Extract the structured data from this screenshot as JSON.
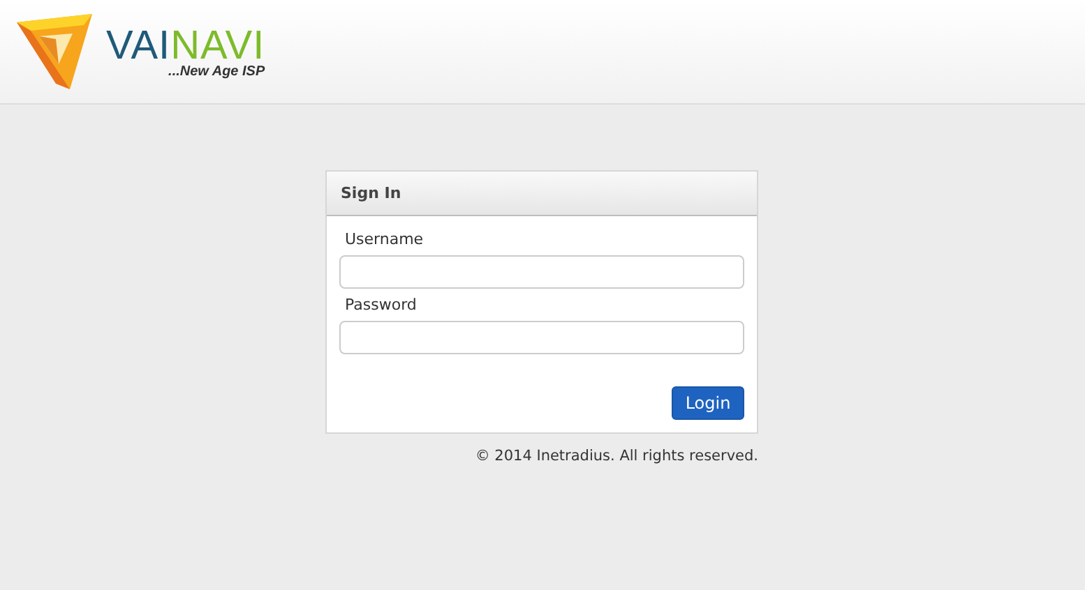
{
  "header": {
    "logo": {
      "wordmark": [
        "VAI",
        "NAVI"
      ],
      "tagline": "...New Age ISP"
    }
  },
  "login_panel": {
    "title": "Sign In",
    "fields": [
      {
        "label": "Username"
      },
      {
        "label": "Password"
      }
    ],
    "button": "Login"
  },
  "footer": "© 2014 Inetradius. All rights reserved."
}
